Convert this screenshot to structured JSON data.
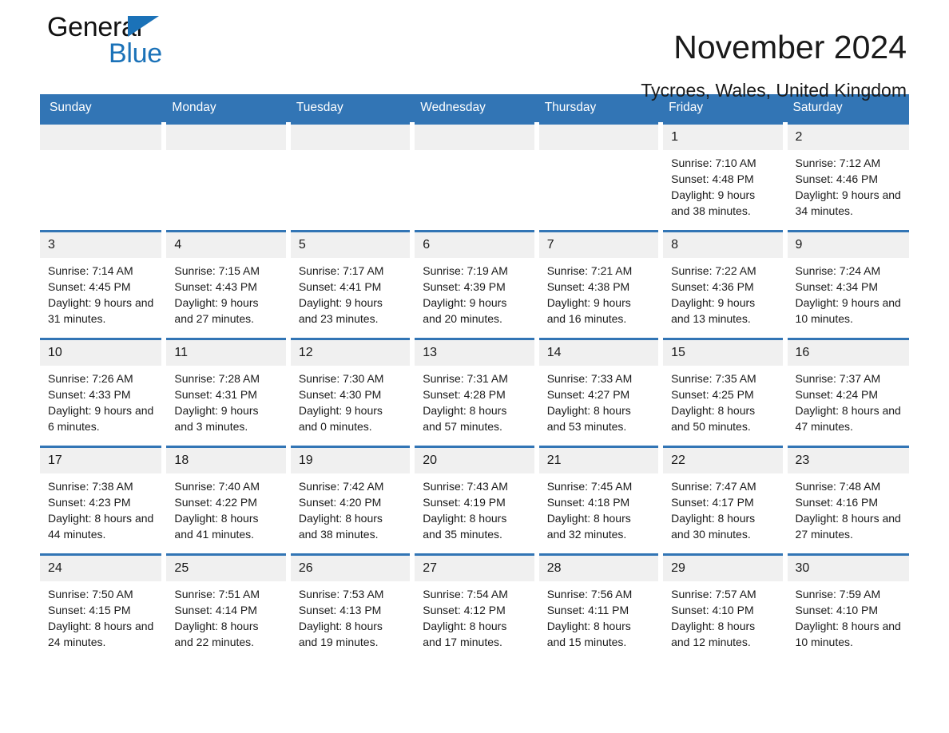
{
  "brand": {
    "word_general": "General",
    "word_blue": "Blue",
    "triangle_color": "#1b72b8",
    "blue_text_color": "#1b72b8"
  },
  "header": {
    "month_title": "November 2024",
    "location": "Tycroes, Wales, United Kingdom",
    "header_bg_color": "#3275b5",
    "daynum_bg_color": "#f0f0f0"
  },
  "calendar": {
    "weekday_headers": [
      "Sunday",
      "Monday",
      "Tuesday",
      "Wednesday",
      "Thursday",
      "Friday",
      "Saturday"
    ],
    "weeks": [
      [
        {
          "day": "",
          "sunrise": "",
          "sunset": "",
          "daylight": ""
        },
        {
          "day": "",
          "sunrise": "",
          "sunset": "",
          "daylight": ""
        },
        {
          "day": "",
          "sunrise": "",
          "sunset": "",
          "daylight": ""
        },
        {
          "day": "",
          "sunrise": "",
          "sunset": "",
          "daylight": ""
        },
        {
          "day": "",
          "sunrise": "",
          "sunset": "",
          "daylight": ""
        },
        {
          "day": "1",
          "sunrise": "Sunrise: 7:10 AM",
          "sunset": "Sunset: 4:48 PM",
          "daylight": "Daylight: 9 hours and 38 minutes."
        },
        {
          "day": "2",
          "sunrise": "Sunrise: 7:12 AM",
          "sunset": "Sunset: 4:46 PM",
          "daylight": "Daylight: 9 hours and 34 minutes."
        }
      ],
      [
        {
          "day": "3",
          "sunrise": "Sunrise: 7:14 AM",
          "sunset": "Sunset: 4:45 PM",
          "daylight": "Daylight: 9 hours and 31 minutes."
        },
        {
          "day": "4",
          "sunrise": "Sunrise: 7:15 AM",
          "sunset": "Sunset: 4:43 PM",
          "daylight": "Daylight: 9 hours and 27 minutes."
        },
        {
          "day": "5",
          "sunrise": "Sunrise: 7:17 AM",
          "sunset": "Sunset: 4:41 PM",
          "daylight": "Daylight: 9 hours and 23 minutes."
        },
        {
          "day": "6",
          "sunrise": "Sunrise: 7:19 AM",
          "sunset": "Sunset: 4:39 PM",
          "daylight": "Daylight: 9 hours and 20 minutes."
        },
        {
          "day": "7",
          "sunrise": "Sunrise: 7:21 AM",
          "sunset": "Sunset: 4:38 PM",
          "daylight": "Daylight: 9 hours and 16 minutes."
        },
        {
          "day": "8",
          "sunrise": "Sunrise: 7:22 AM",
          "sunset": "Sunset: 4:36 PM",
          "daylight": "Daylight: 9 hours and 13 minutes."
        },
        {
          "day": "9",
          "sunrise": "Sunrise: 7:24 AM",
          "sunset": "Sunset: 4:34 PM",
          "daylight": "Daylight: 9 hours and 10 minutes."
        }
      ],
      [
        {
          "day": "10",
          "sunrise": "Sunrise: 7:26 AM",
          "sunset": "Sunset: 4:33 PM",
          "daylight": "Daylight: 9 hours and 6 minutes."
        },
        {
          "day": "11",
          "sunrise": "Sunrise: 7:28 AM",
          "sunset": "Sunset: 4:31 PM",
          "daylight": "Daylight: 9 hours and 3 minutes."
        },
        {
          "day": "12",
          "sunrise": "Sunrise: 7:30 AM",
          "sunset": "Sunset: 4:30 PM",
          "daylight": "Daylight: 9 hours and 0 minutes."
        },
        {
          "day": "13",
          "sunrise": "Sunrise: 7:31 AM",
          "sunset": "Sunset: 4:28 PM",
          "daylight": "Daylight: 8 hours and 57 minutes."
        },
        {
          "day": "14",
          "sunrise": "Sunrise: 7:33 AM",
          "sunset": "Sunset: 4:27 PM",
          "daylight": "Daylight: 8 hours and 53 minutes."
        },
        {
          "day": "15",
          "sunrise": "Sunrise: 7:35 AM",
          "sunset": "Sunset: 4:25 PM",
          "daylight": "Daylight: 8 hours and 50 minutes."
        },
        {
          "day": "16",
          "sunrise": "Sunrise: 7:37 AM",
          "sunset": "Sunset: 4:24 PM",
          "daylight": "Daylight: 8 hours and 47 minutes."
        }
      ],
      [
        {
          "day": "17",
          "sunrise": "Sunrise: 7:38 AM",
          "sunset": "Sunset: 4:23 PM",
          "daylight": "Daylight: 8 hours and 44 minutes."
        },
        {
          "day": "18",
          "sunrise": "Sunrise: 7:40 AM",
          "sunset": "Sunset: 4:22 PM",
          "daylight": "Daylight: 8 hours and 41 minutes."
        },
        {
          "day": "19",
          "sunrise": "Sunrise: 7:42 AM",
          "sunset": "Sunset: 4:20 PM",
          "daylight": "Daylight: 8 hours and 38 minutes."
        },
        {
          "day": "20",
          "sunrise": "Sunrise: 7:43 AM",
          "sunset": "Sunset: 4:19 PM",
          "daylight": "Daylight: 8 hours and 35 minutes."
        },
        {
          "day": "21",
          "sunrise": "Sunrise: 7:45 AM",
          "sunset": "Sunset: 4:18 PM",
          "daylight": "Daylight: 8 hours and 32 minutes."
        },
        {
          "day": "22",
          "sunrise": "Sunrise: 7:47 AM",
          "sunset": "Sunset: 4:17 PM",
          "daylight": "Daylight: 8 hours and 30 minutes."
        },
        {
          "day": "23",
          "sunrise": "Sunrise: 7:48 AM",
          "sunset": "Sunset: 4:16 PM",
          "daylight": "Daylight: 8 hours and 27 minutes."
        }
      ],
      [
        {
          "day": "24",
          "sunrise": "Sunrise: 7:50 AM",
          "sunset": "Sunset: 4:15 PM",
          "daylight": "Daylight: 8 hours and 24 minutes."
        },
        {
          "day": "25",
          "sunrise": "Sunrise: 7:51 AM",
          "sunset": "Sunset: 4:14 PM",
          "daylight": "Daylight: 8 hours and 22 minutes."
        },
        {
          "day": "26",
          "sunrise": "Sunrise: 7:53 AM",
          "sunset": "Sunset: 4:13 PM",
          "daylight": "Daylight: 8 hours and 19 minutes."
        },
        {
          "day": "27",
          "sunrise": "Sunrise: 7:54 AM",
          "sunset": "Sunset: 4:12 PM",
          "daylight": "Daylight: 8 hours and 17 minutes."
        },
        {
          "day": "28",
          "sunrise": "Sunrise: 7:56 AM",
          "sunset": "Sunset: 4:11 PM",
          "daylight": "Daylight: 8 hours and 15 minutes."
        },
        {
          "day": "29",
          "sunrise": "Sunrise: 7:57 AM",
          "sunset": "Sunset: 4:10 PM",
          "daylight": "Daylight: 8 hours and 12 minutes."
        },
        {
          "day": "30",
          "sunrise": "Sunrise: 7:59 AM",
          "sunset": "Sunset: 4:10 PM",
          "daylight": "Daylight: 8 hours and 10 minutes."
        }
      ]
    ]
  }
}
